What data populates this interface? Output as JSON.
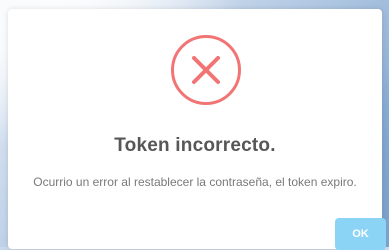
{
  "dialog": {
    "icon": "error-x-icon",
    "icon_color": "#f27474",
    "title": "Token incorrecto.",
    "message": "Ocurrio un error al restablecer la contraseña, el token expiro.",
    "confirm_label": "OK",
    "confirm_color": "#8cd4f5"
  }
}
